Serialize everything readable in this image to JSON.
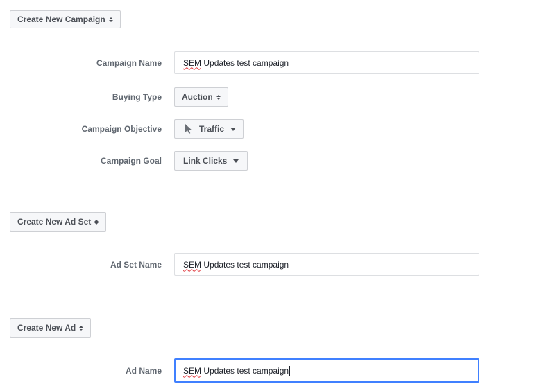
{
  "campaign_section": {
    "button_label": "Create New Campaign",
    "campaign_name_label": "Campaign Name",
    "campaign_name_value_prefix": "SEM",
    "campaign_name_value_rest": " Updates test campaign",
    "buying_type_label": "Buying Type",
    "buying_type_value": "Auction",
    "objective_label": "Campaign Objective",
    "objective_value": "Traffic",
    "objective_icon": "cursor-pointer-icon",
    "goal_label": "Campaign Goal",
    "goal_value": "Link Clicks"
  },
  "adset_section": {
    "button_label": "Create New Ad Set",
    "adset_name_label": "Ad Set Name",
    "adset_name_value_prefix": "SEM",
    "adset_name_value_rest": " Updates test campaign"
  },
  "ad_section": {
    "button_label": "Create New Ad",
    "ad_name_label": "Ad Name",
    "ad_name_value_prefix": "SEM",
    "ad_name_value_rest": " Updates test campaign"
  },
  "colors": {
    "focus_border": "#4080ff",
    "spellcheck": "#e0393e",
    "divider": "#dddfe2"
  }
}
